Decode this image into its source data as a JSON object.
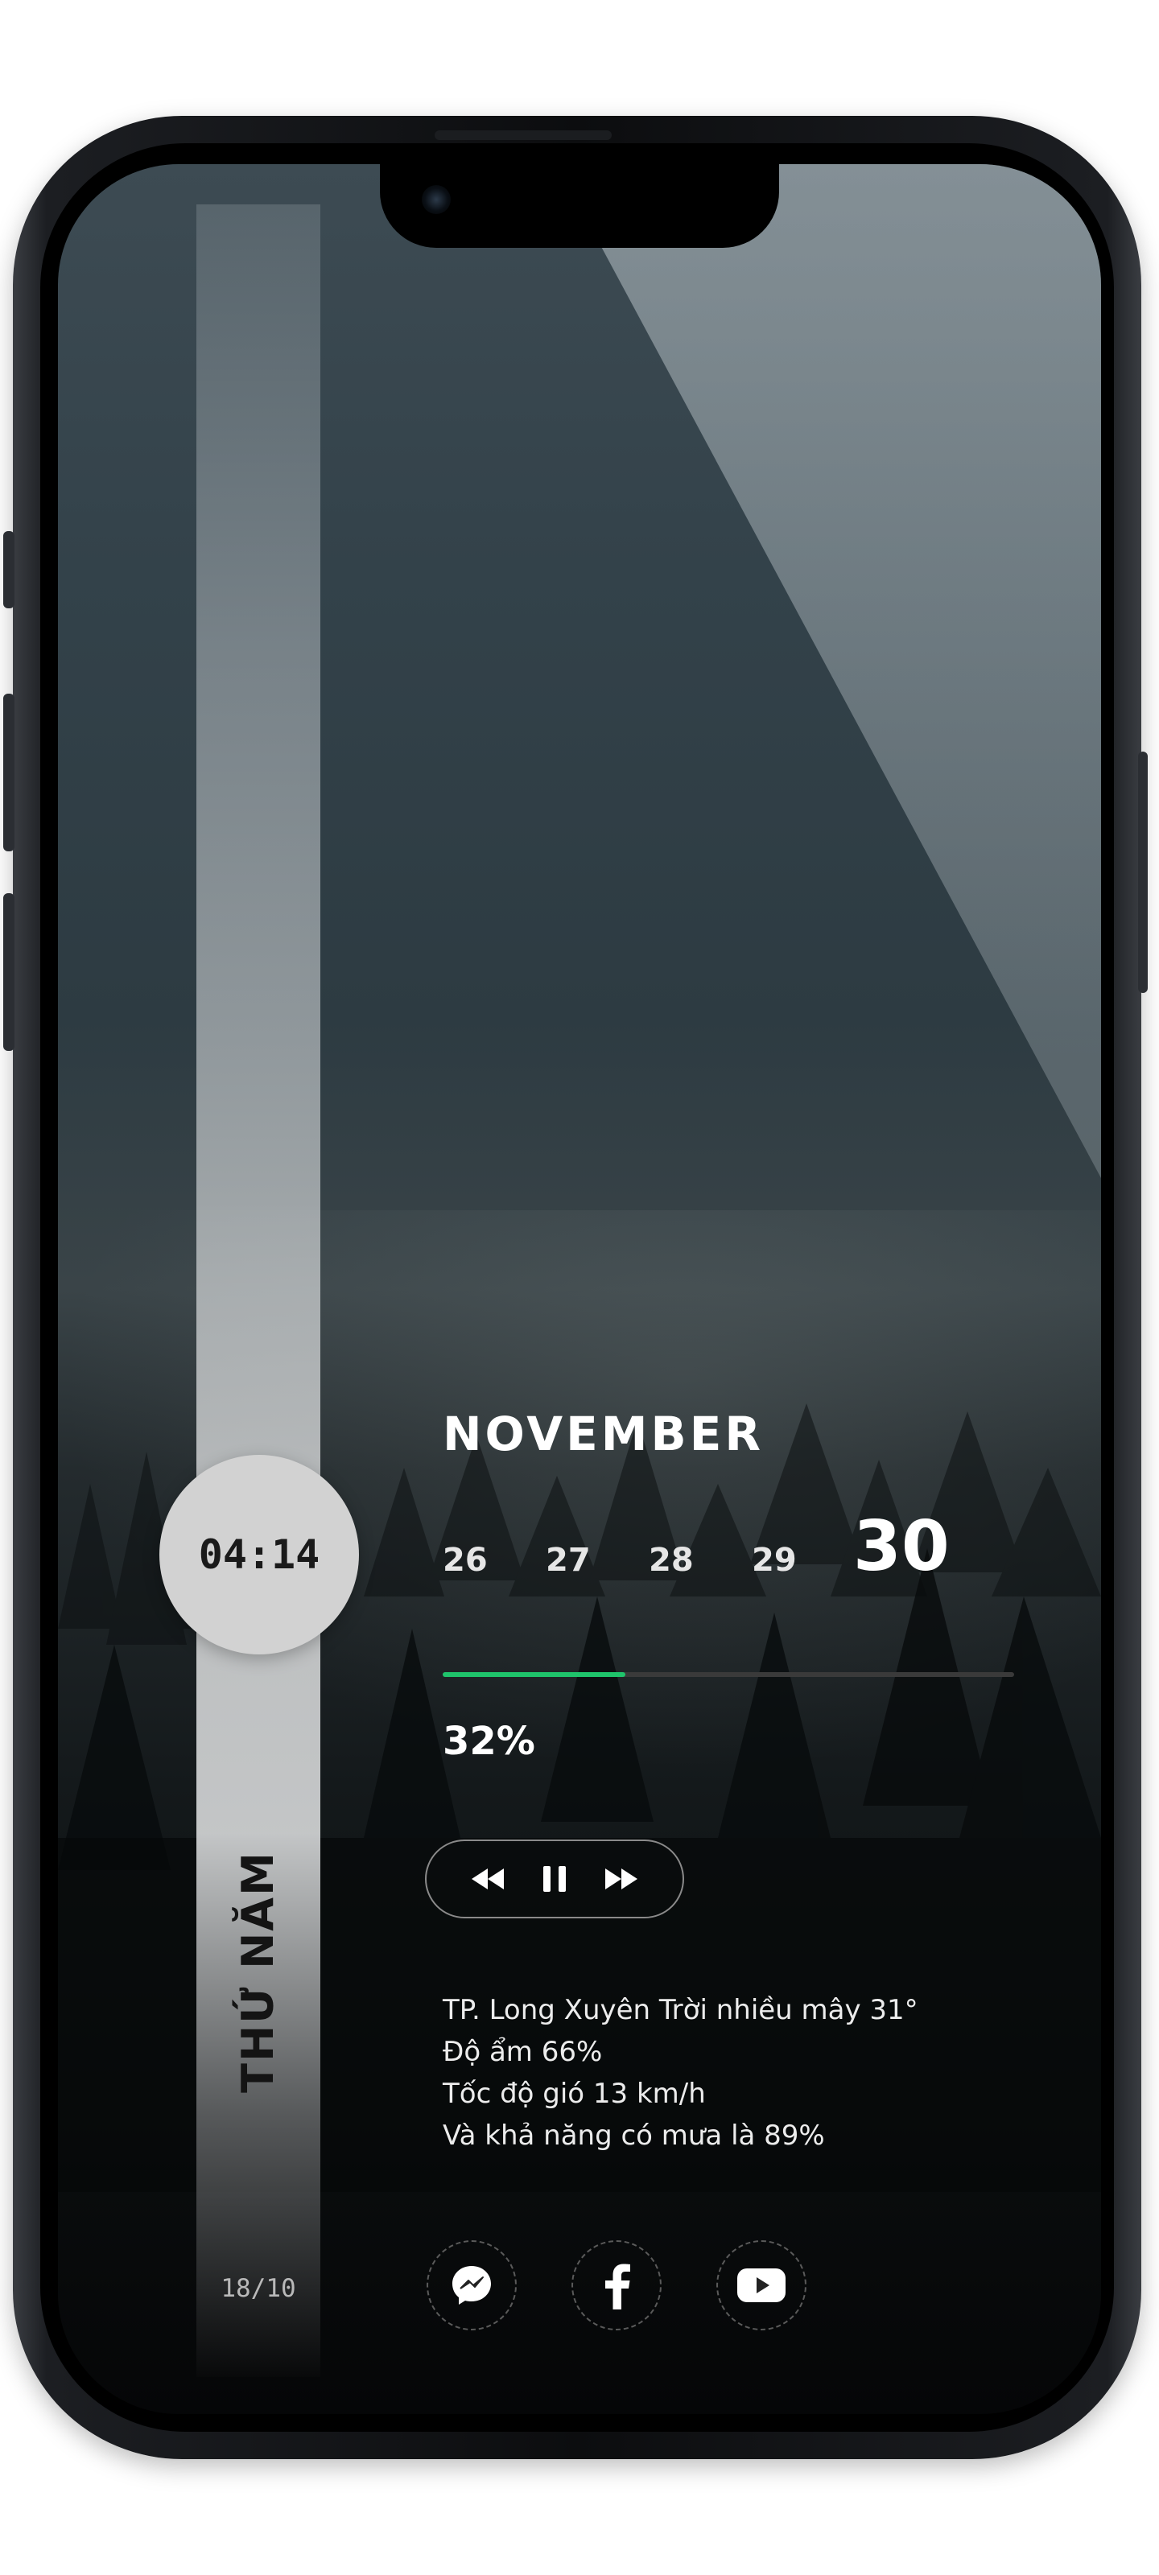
{
  "lockscreen": {
    "time": "04:14",
    "weekday": "THỨ NĂM",
    "date_short": "18/10",
    "month": "NOVEMBER",
    "days": [
      "26",
      "27",
      "28",
      "29",
      "30"
    ],
    "active_day": "30",
    "progress_percent": 32,
    "progress_label": "32%",
    "weather_lines": [
      "TP. Long Xuyên Trời nhiều mây 31°",
      "Độ ẩm 66%",
      "Tốc độ gió 13 km/h",
      "Và khả năng có mưa là 89%"
    ]
  },
  "media_controls": {
    "rewind_icon": "rewind-icon",
    "pause_icon": "pause-icon",
    "forward_icon": "fast-forward-icon"
  },
  "socials": [
    "messenger-icon",
    "facebook-icon",
    "youtube-icon"
  ],
  "colors": {
    "accent": "#1fc36b",
    "circle": "#d2d2d2",
    "text": "#ffffff"
  }
}
